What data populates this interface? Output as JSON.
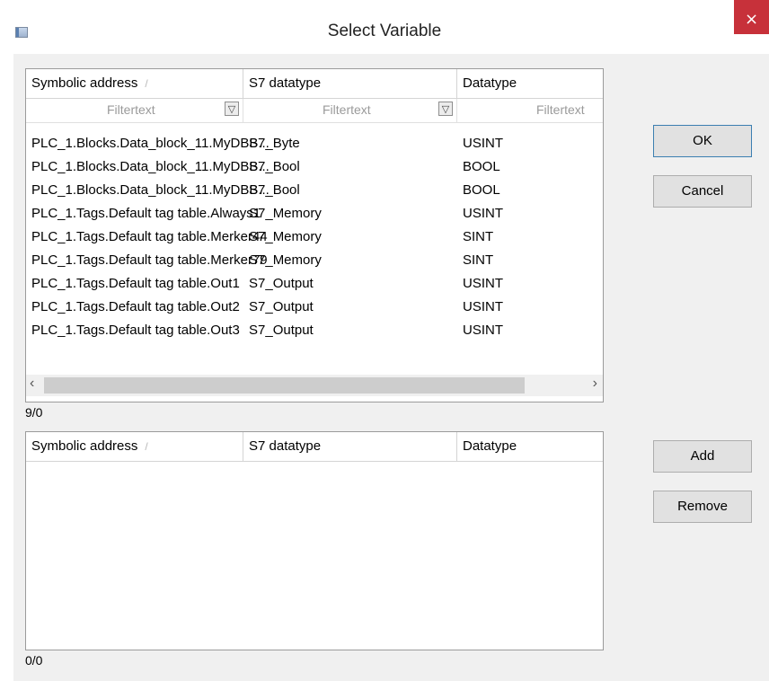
{
  "window": {
    "title": "Select Variable",
    "close_label": "×"
  },
  "top_grid": {
    "columns": [
      "Symbolic address",
      "S7 datatype",
      "Datatype"
    ],
    "sort_indicator": "/",
    "filter_placeholder": "Filtertext",
    "rows": [
      [
        "PLC_1.Blocks.Data_block_11.MyDBB...",
        "S7_Byte",
        "USINT"
      ],
      [
        "PLC_1.Blocks.Data_block_11.MyDBB...",
        "S7_Bool",
        "BOOL"
      ],
      [
        "PLC_1.Blocks.Data_block_11.MyDBB...",
        "S7_Bool",
        "BOOL"
      ],
      [
        "PLC_1.Tags.Default tag table.Always1",
        "S7_Memory",
        "USINT"
      ],
      [
        "PLC_1.Tags.Default tag table.Merker44",
        "S7_Memory",
        "SINT"
      ],
      [
        "PLC_1.Tags.Default tag table.Merker79",
        "S7_Memory",
        "SINT"
      ],
      [
        "PLC_1.Tags.Default tag table.Out1",
        "S7_Output",
        "USINT"
      ],
      [
        "PLC_1.Tags.Default tag table.Out2",
        "S7_Output",
        "USINT"
      ],
      [
        "PLC_1.Tags.Default tag table.Out3",
        "S7_Output",
        "USINT"
      ]
    ],
    "count": "9/0"
  },
  "bottom_grid": {
    "columns": [
      "Symbolic address",
      "S7 datatype",
      "Datatype"
    ],
    "sort_indicator": "/",
    "count": "0/0"
  },
  "buttons": {
    "ok": "OK",
    "cancel": "Cancel",
    "add": "Add",
    "remove": "Remove"
  },
  "scroll": {
    "left": "‹",
    "right": "›"
  },
  "icons": {
    "app": "window-icon",
    "filter": "funnel-icon",
    "close": "close-icon"
  },
  "colors": {
    "close_bg": "#c7313a",
    "default_button_border": "#3c7fb1"
  }
}
